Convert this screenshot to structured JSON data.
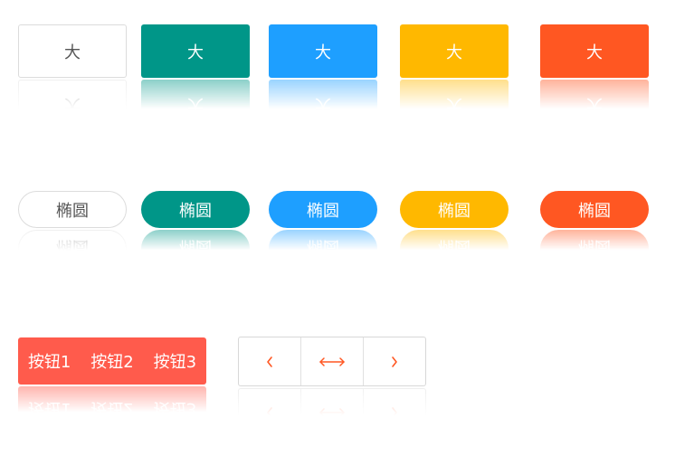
{
  "rect_buttons": [
    {
      "label": "大",
      "style": "plain"
    },
    {
      "label": "大",
      "style": "teal"
    },
    {
      "label": "大",
      "style": "blue"
    },
    {
      "label": "大",
      "style": "gold"
    },
    {
      "label": "大",
      "style": "orange"
    }
  ],
  "round_buttons": [
    {
      "label": "椭圆",
      "style": "plain"
    },
    {
      "label": "椭圆",
      "style": "teal"
    },
    {
      "label": "椭圆",
      "style": "blue"
    },
    {
      "label": "椭圆",
      "style": "gold"
    },
    {
      "label": "椭圆",
      "style": "orange"
    }
  ],
  "button_group": [
    "按钮1",
    "按钮2",
    "按钮3"
  ],
  "icon_group": [
    "chevron-left-icon",
    "left-right-arrow-icon",
    "chevron-right-icon"
  ],
  "colors": {
    "plain": "#ffffff",
    "teal": "#009688",
    "blue": "#1e9fff",
    "gold": "#ffb800",
    "orange": "#ff5722",
    "group_red": "#ff5b4c"
  }
}
